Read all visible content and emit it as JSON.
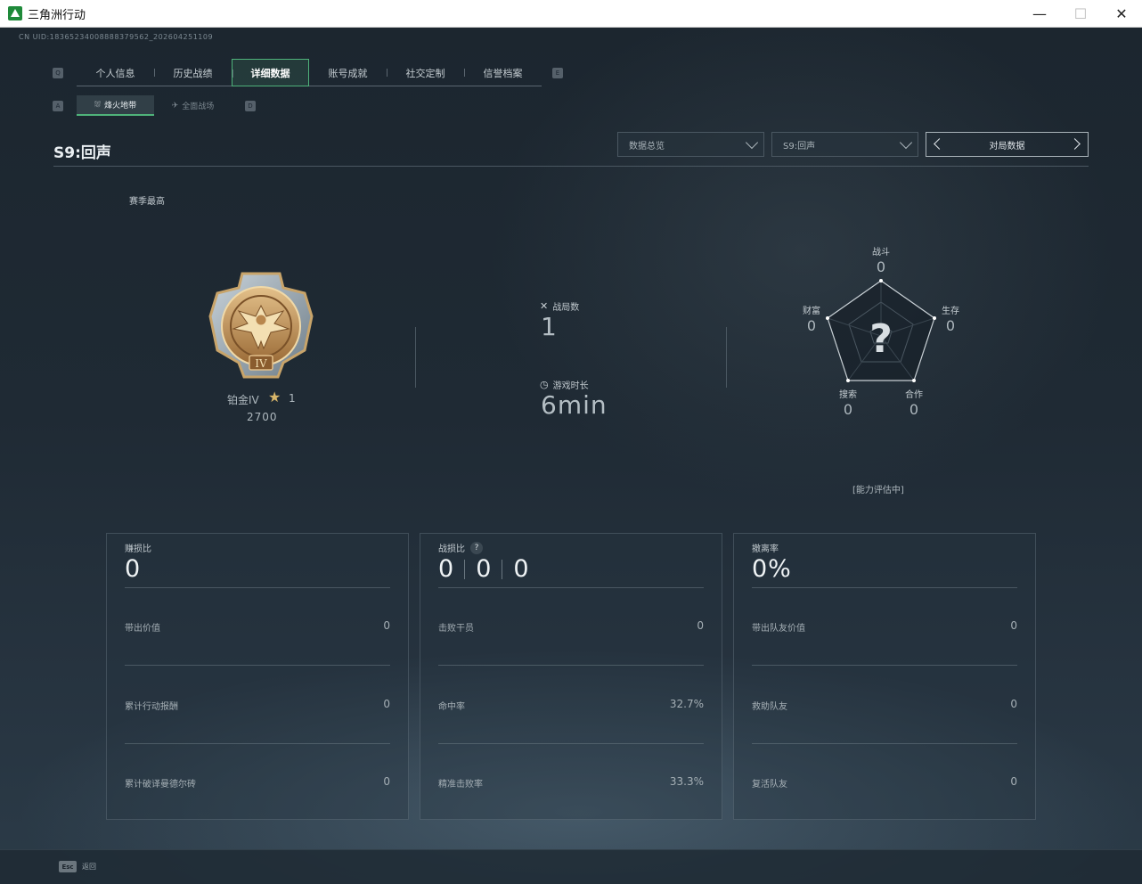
{
  "window": {
    "title": "三角洲行动",
    "minimize": "—",
    "maximize": "☐",
    "close": "✕"
  },
  "cnuid": "CN UID:18365234008888379562_202604251109",
  "top_left_key": "Q",
  "top_right_key": "E",
  "main_tabs": [
    "个人信息",
    "历史战绩",
    "详细数据",
    "账号成就",
    "社交定制",
    "信誉档案"
  ],
  "active_main_tab": "详细数据",
  "sub_left_key": "A",
  "sub_right_key": "D",
  "sub_tabs": [
    {
      "label": "烽火地带",
      "icon": "⛆"
    },
    {
      "label": "全面战场",
      "icon": "✈"
    }
  ],
  "season": {
    "title": "S9:回声",
    "data_select": "数据总览",
    "season_select": "S9:回声",
    "match_nav": "对局数据"
  },
  "rank": {
    "header": "赛季最高",
    "name": "铂金IV",
    "stars": "1",
    "points": "2700",
    "medal_numeral": "IV"
  },
  "summary": {
    "matches_label": "战局数",
    "matches_value": "1",
    "time_label": "游戏时长",
    "time_value": "6min"
  },
  "radar": {
    "axes": [
      {
        "label": "战斗",
        "value": "0"
      },
      {
        "label": "生存",
        "value": "0"
      },
      {
        "label": "合作",
        "value": "0"
      },
      {
        "label": "搜索",
        "value": "0"
      },
      {
        "label": "财富",
        "value": "0"
      }
    ],
    "center_mark": "?",
    "status": "[能力评估中]"
  },
  "panels": [
    {
      "title": "赚损比",
      "big": "0",
      "rows": [
        {
          "label": "带出价值",
          "value": "0"
        },
        {
          "label": "累计行动报酬",
          "value": "0"
        },
        {
          "label": "累计破译曼德尔砖",
          "value": "0"
        }
      ]
    },
    {
      "title": "战损比",
      "help": "?",
      "ratio": [
        "0",
        "0",
        "0"
      ],
      "rows": [
        {
          "label": "击败干员",
          "value": "0"
        },
        {
          "label": "命中率",
          "value": "32.7%"
        },
        {
          "label": "精准击败率",
          "value": "33.3%"
        }
      ]
    },
    {
      "title": "撤离率",
      "big": "0%",
      "rows": [
        {
          "label": "带出队友价值",
          "value": "0"
        },
        {
          "label": "救助队友",
          "value": "0"
        },
        {
          "label": "复活队友",
          "value": "0"
        }
      ]
    }
  ],
  "footer": {
    "esc_key": "Esc",
    "esc_label": "返回"
  },
  "colors": {
    "accent": "#4fb27a",
    "background": "#1f2a34",
    "medal_gold": "#c89a5a"
  }
}
